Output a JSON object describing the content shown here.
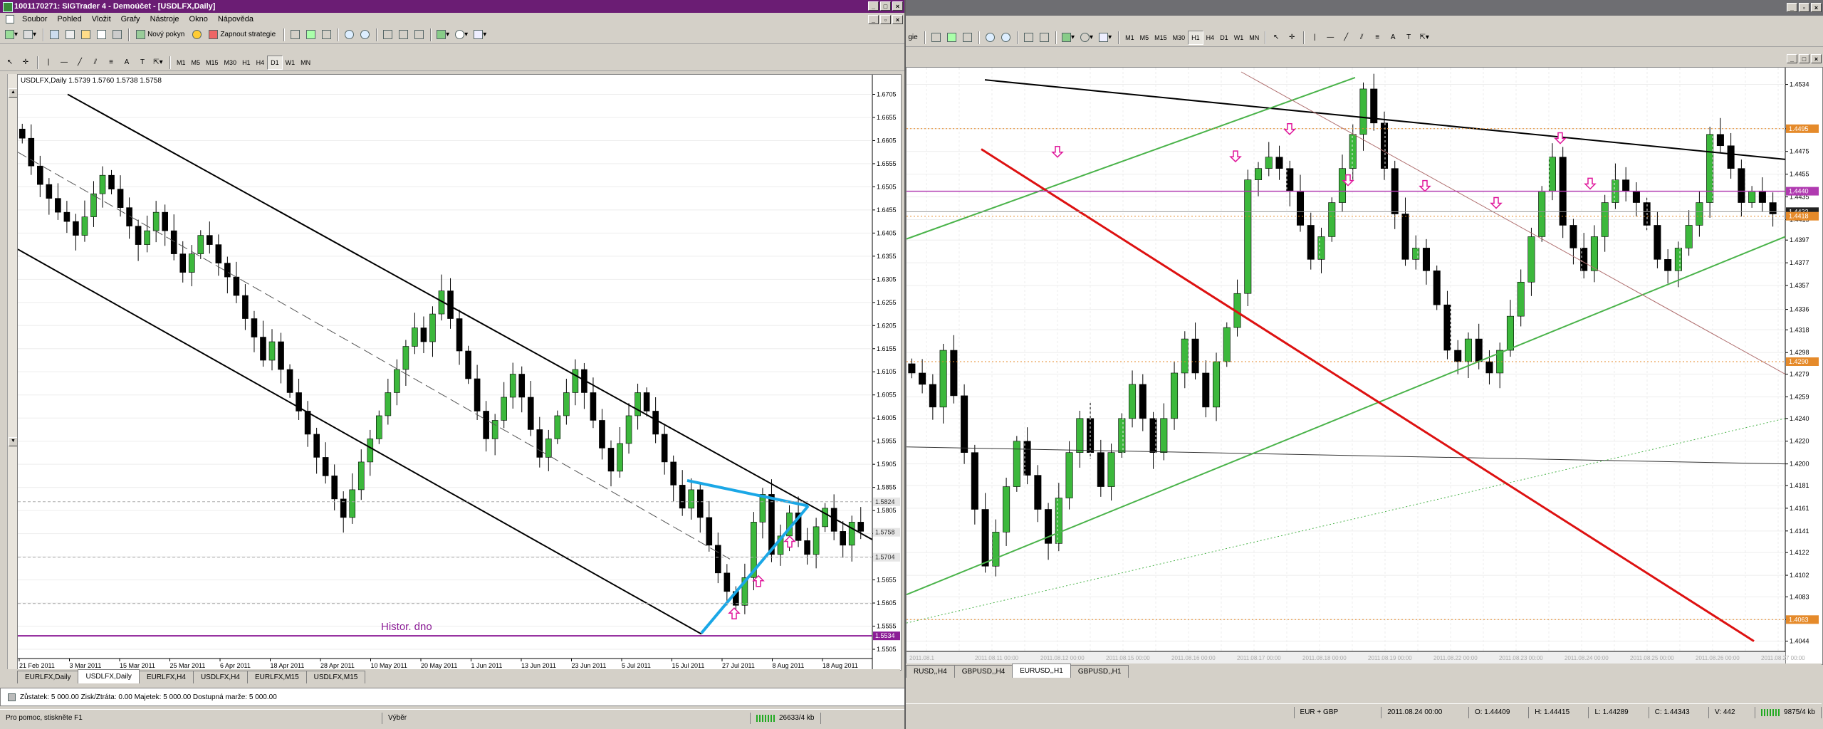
{
  "left": {
    "title": "1001170271: SIGTrader 4 - Demoúčet - [USDLFX,Daily]",
    "menu": [
      "Soubor",
      "Pohled",
      "Vložit",
      "Grafy",
      "Nástroje",
      "Okno",
      "Nápověda"
    ],
    "new_order": "Nový pokyn",
    "strategy": "Zapnout strategie",
    "timeframes": [
      "M1",
      "M5",
      "M15",
      "M30",
      "H1",
      "H4",
      "D1",
      "W1",
      "MN"
    ],
    "active_tf": "D1",
    "info": "USDLFX,Daily  1.5739 1.5760 1.5738 1.5758",
    "annotation": "Histor. dno",
    "tabs": [
      "EURLFX,Daily",
      "USDLFX,Daily",
      "EURLFX,H4",
      "USDLFX,H4",
      "EURLFX,M15",
      "USDLFX,M15"
    ],
    "active_tab": "USDLFX,Daily",
    "account": "Zůstatek: 5 000.00  Zisk/Ztráta: 0.00  Majetek: 5 000.00  Dostupná marže: 5 000.00",
    "status_help": "Pro pomoc, stiskněte F1",
    "status_mode": "Výběr",
    "status_kb": "26633/4 kb"
  },
  "right": {
    "timeframes": [
      "M1",
      "M5",
      "M15",
      "M30",
      "H1",
      "H4",
      "D1",
      "W1",
      "MN"
    ],
    "active_tf": "H1",
    "tabs": [
      "RUSD,,H4",
      "GBPUSD,,H4",
      "EURUSD,,H1",
      "GBPUSD,,H1"
    ],
    "active_tab": "EURUSD,,H1",
    "status_symbols": "EUR + GBP",
    "status_date": "2011.08.24 00:00",
    "status_o": "O: 1.44409",
    "status_h": "H: 1.44415",
    "status_l": "L: 1.44289",
    "status_c": "C: 1.44343",
    "status_v": "V: 442",
    "status_kb": "9875/4 kb",
    "xlabels": [
      "2011.08.1",
      "2011.08.11 00:00",
      "2011.08.12 00:00",
      "2011.08.15 00:00",
      "2011.08.16 00:00",
      "2011.08.17 00:00",
      "2011.08.18 00:00",
      "2011.08.19 00:00",
      "2011.08.22 00:00",
      "2011.08.23 00:00",
      "2011.08.24 00:00",
      "2011.08.25 00:00",
      "2011.08.26 00:00",
      "2011.08.27 00:00"
    ]
  },
  "chart_data": [
    {
      "type": "candlestick",
      "symbol": "USDLFX",
      "timeframe": "Daily",
      "title": "USDLFX,Daily",
      "ohlc_last": {
        "open": 1.5739,
        "high": 1.576,
        "low": 1.5738,
        "close": 1.5758
      },
      "y_ticks": [
        1.6705,
        1.6655,
        1.6605,
        1.6555,
        1.6505,
        1.6455,
        1.6405,
        1.6355,
        1.6305,
        1.6255,
        1.6205,
        1.6155,
        1.6105,
        1.6055,
        1.6005,
        1.5955,
        1.5905,
        1.5855,
        1.5805,
        1.5755,
        1.5705,
        1.5655,
        1.5605,
        1.5555,
        1.5505
      ],
      "ylim": [
        1.5485,
        1.6735
      ],
      "x_ticks": [
        "21 Feb 2011",
        "3 Mar 2011",
        "15 Mar 2011",
        "25 Mar 2011",
        "6 Apr 2011",
        "18 Apr 2011",
        "28 Apr 2011",
        "10 May 2011",
        "20 May 2011",
        "1 Jun 2011",
        "13 Jun 2011",
        "23 Jun 2011",
        "5 Jul 2011",
        "15 Jul 2011",
        "27 Jul 2011",
        "8 Aug 2011",
        "18 Aug 2011"
      ],
      "price_tags": [
        1.5824,
        1.5758,
        1.5704,
        1.5534
      ],
      "support_level": 1.5534,
      "closes": [
        1.661,
        1.655,
        1.651,
        1.648,
        1.645,
        1.643,
        1.64,
        1.644,
        1.649,
        1.653,
        1.65,
        1.646,
        1.642,
        1.638,
        1.641,
        1.645,
        1.641,
        1.636,
        1.632,
        1.636,
        1.64,
        1.638,
        1.634,
        1.631,
        1.627,
        1.622,
        1.618,
        1.613,
        1.617,
        1.611,
        1.606,
        1.602,
        1.597,
        1.592,
        1.588,
        1.583,
        1.579,
        1.585,
        1.591,
        1.596,
        1.601,
        1.606,
        1.611,
        1.616,
        1.62,
        1.617,
        1.623,
        1.628,
        1.622,
        1.615,
        1.609,
        1.602,
        1.596,
        1.6,
        1.605,
        1.61,
        1.605,
        1.598,
        1.592,
        1.596,
        1.601,
        1.606,
        1.611,
        1.606,
        1.6,
        1.594,
        1.589,
        1.595,
        1.601,
        1.606,
        1.602,
        1.597,
        1.591,
        1.586,
        1.581,
        1.585,
        1.579,
        1.573,
        1.567,
        1.563,
        1.56,
        1.566,
        1.578,
        1.584,
        1.571,
        1.575,
        1.58,
        1.574,
        1.571,
        1.577,
        1.581,
        1.576,
        1.573,
        1.578,
        1.576
      ]
    },
    {
      "type": "candlestick",
      "symbol": "EURUSD",
      "timeframe": "H1",
      "y_ticks": [
        1.4534,
        1.4495,
        1.4475,
        1.4455,
        1.4435,
        1.4415,
        1.4397,
        1.4377,
        1.4357,
        1.4336,
        1.4318,
        1.4298,
        1.4279,
        1.4259,
        1.424,
        1.422,
        1.42,
        1.4181,
        1.4161,
        1.4141,
        1.4122,
        1.4102,
        1.4083,
        1.4063,
        1.4044
      ],
      "ylim": [
        1.4035,
        1.4545
      ],
      "price_tags": [
        1.4495,
        1.444,
        1.4422,
        1.4418,
        1.429,
        1.4063
      ],
      "current_level": 1.444,
      "closes": [
        1.428,
        1.427,
        1.425,
        1.43,
        1.426,
        1.421,
        1.416,
        1.411,
        1.414,
        1.418,
        1.422,
        1.419,
        1.416,
        1.413,
        1.417,
        1.421,
        1.424,
        1.421,
        1.418,
        1.421,
        1.424,
        1.427,
        1.424,
        1.421,
        1.424,
        1.428,
        1.431,
        1.428,
        1.425,
        1.429,
        1.432,
        1.435,
        1.445,
        1.446,
        1.447,
        1.446,
        1.444,
        1.441,
        1.438,
        1.44,
        1.443,
        1.446,
        1.449,
        1.453,
        1.45,
        1.446,
        1.442,
        1.438,
        1.439,
        1.437,
        1.434,
        1.43,
        1.429,
        1.431,
        1.429,
        1.428,
        1.43,
        1.433,
        1.436,
        1.44,
        1.444,
        1.447,
        1.441,
        1.439,
        1.437,
        1.44,
        1.443,
        1.445,
        1.444,
        1.443,
        1.441,
        1.438,
        1.437,
        1.439,
        1.441,
        1.443,
        1.449,
        1.448,
        1.446,
        1.443,
        1.444,
        1.443,
        1.442
      ]
    }
  ]
}
